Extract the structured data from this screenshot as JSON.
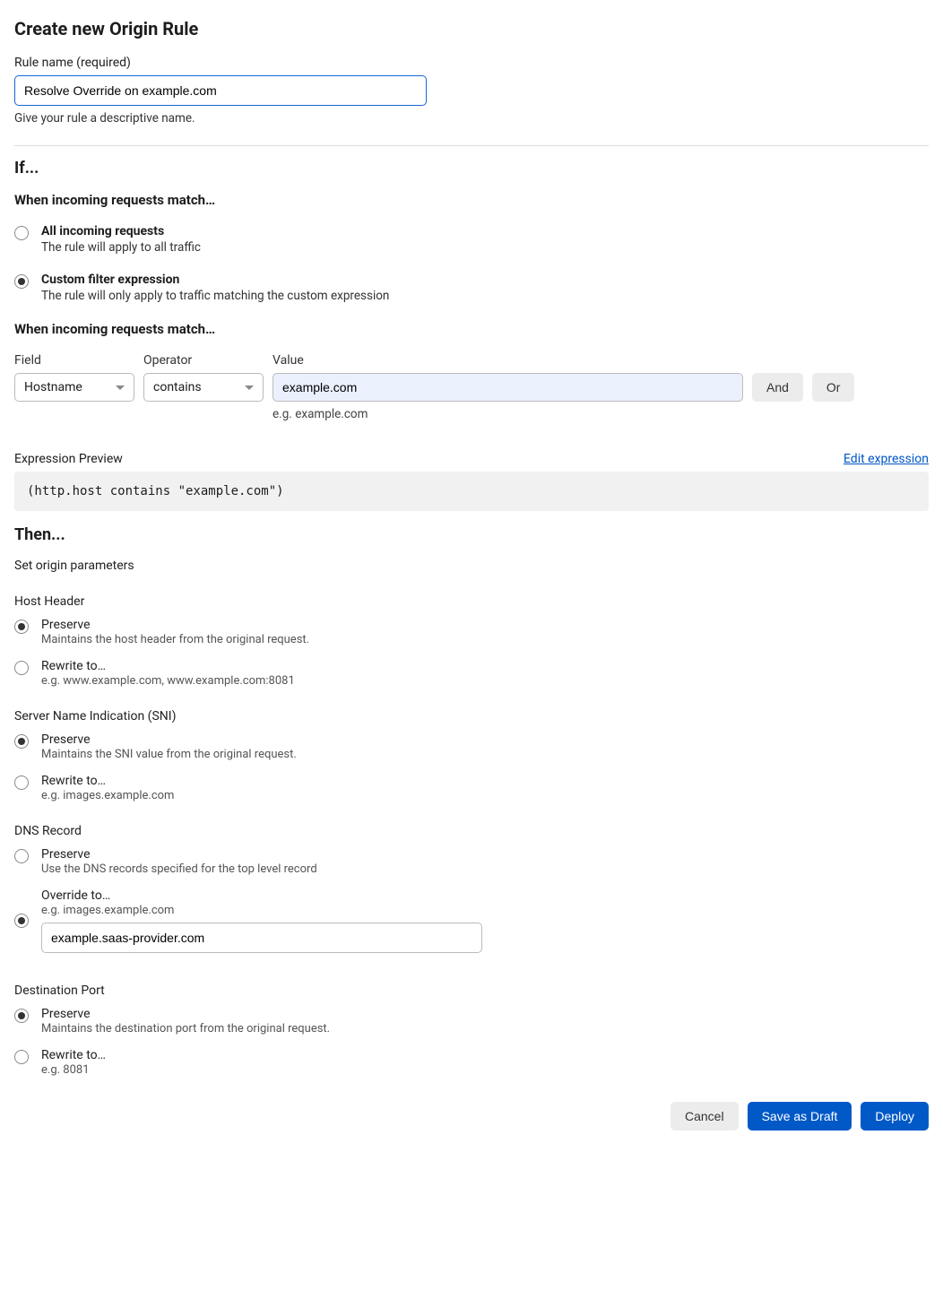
{
  "page": {
    "title": "Create new Origin Rule"
  },
  "ruleName": {
    "label": "Rule name (required)",
    "value": "Resolve Override on example.com",
    "hint": "Give your rule a descriptive name."
  },
  "if": {
    "heading": "If...",
    "subheading": "When incoming requests match…",
    "opt_all": {
      "title": "All incoming requests",
      "desc": "The rule will apply to all traffic"
    },
    "opt_custom": {
      "title": "Custom filter expression",
      "desc": "The rule will only apply to traffic matching the custom expression"
    },
    "matchHeading": "When incoming requests match…",
    "labels": {
      "field": "Field",
      "operator": "Operator",
      "value": "Value"
    },
    "field": "Hostname",
    "operator": "contains",
    "value": "example.com",
    "value_eg": "e.g. example.com",
    "and": "And",
    "or": "Or",
    "previewLabel": "Expression Preview",
    "editLink": "Edit expression",
    "preview": "(http.host contains \"example.com\")"
  },
  "then": {
    "heading": "Then...",
    "sub": "Set origin parameters",
    "hostHeader": {
      "label": "Host Header",
      "preserve": {
        "title": "Preserve",
        "desc": "Maintains the host header from the original request."
      },
      "rewrite": {
        "title": "Rewrite to…",
        "desc": "e.g. www.example.com, www.example.com:8081"
      }
    },
    "sni": {
      "label": "Server Name Indication (SNI)",
      "preserve": {
        "title": "Preserve",
        "desc": "Maintains the SNI value from the original request."
      },
      "rewrite": {
        "title": "Rewrite to…",
        "desc": "e.g. images.example.com"
      }
    },
    "dns": {
      "label": "DNS Record",
      "preserve": {
        "title": "Preserve",
        "desc": "Use the DNS records specified for the top level record"
      },
      "override": {
        "title": "Override to…",
        "desc": "e.g. images.example.com",
        "value": "example.saas-provider.com"
      }
    },
    "port": {
      "label": "Destination Port",
      "preserve": {
        "title": "Preserve",
        "desc": "Maintains the destination port from the original request."
      },
      "rewrite": {
        "title": "Rewrite to…",
        "desc": "e.g. 8081"
      }
    }
  },
  "footer": {
    "cancel": "Cancel",
    "draft": "Save as Draft",
    "deploy": "Deploy"
  }
}
